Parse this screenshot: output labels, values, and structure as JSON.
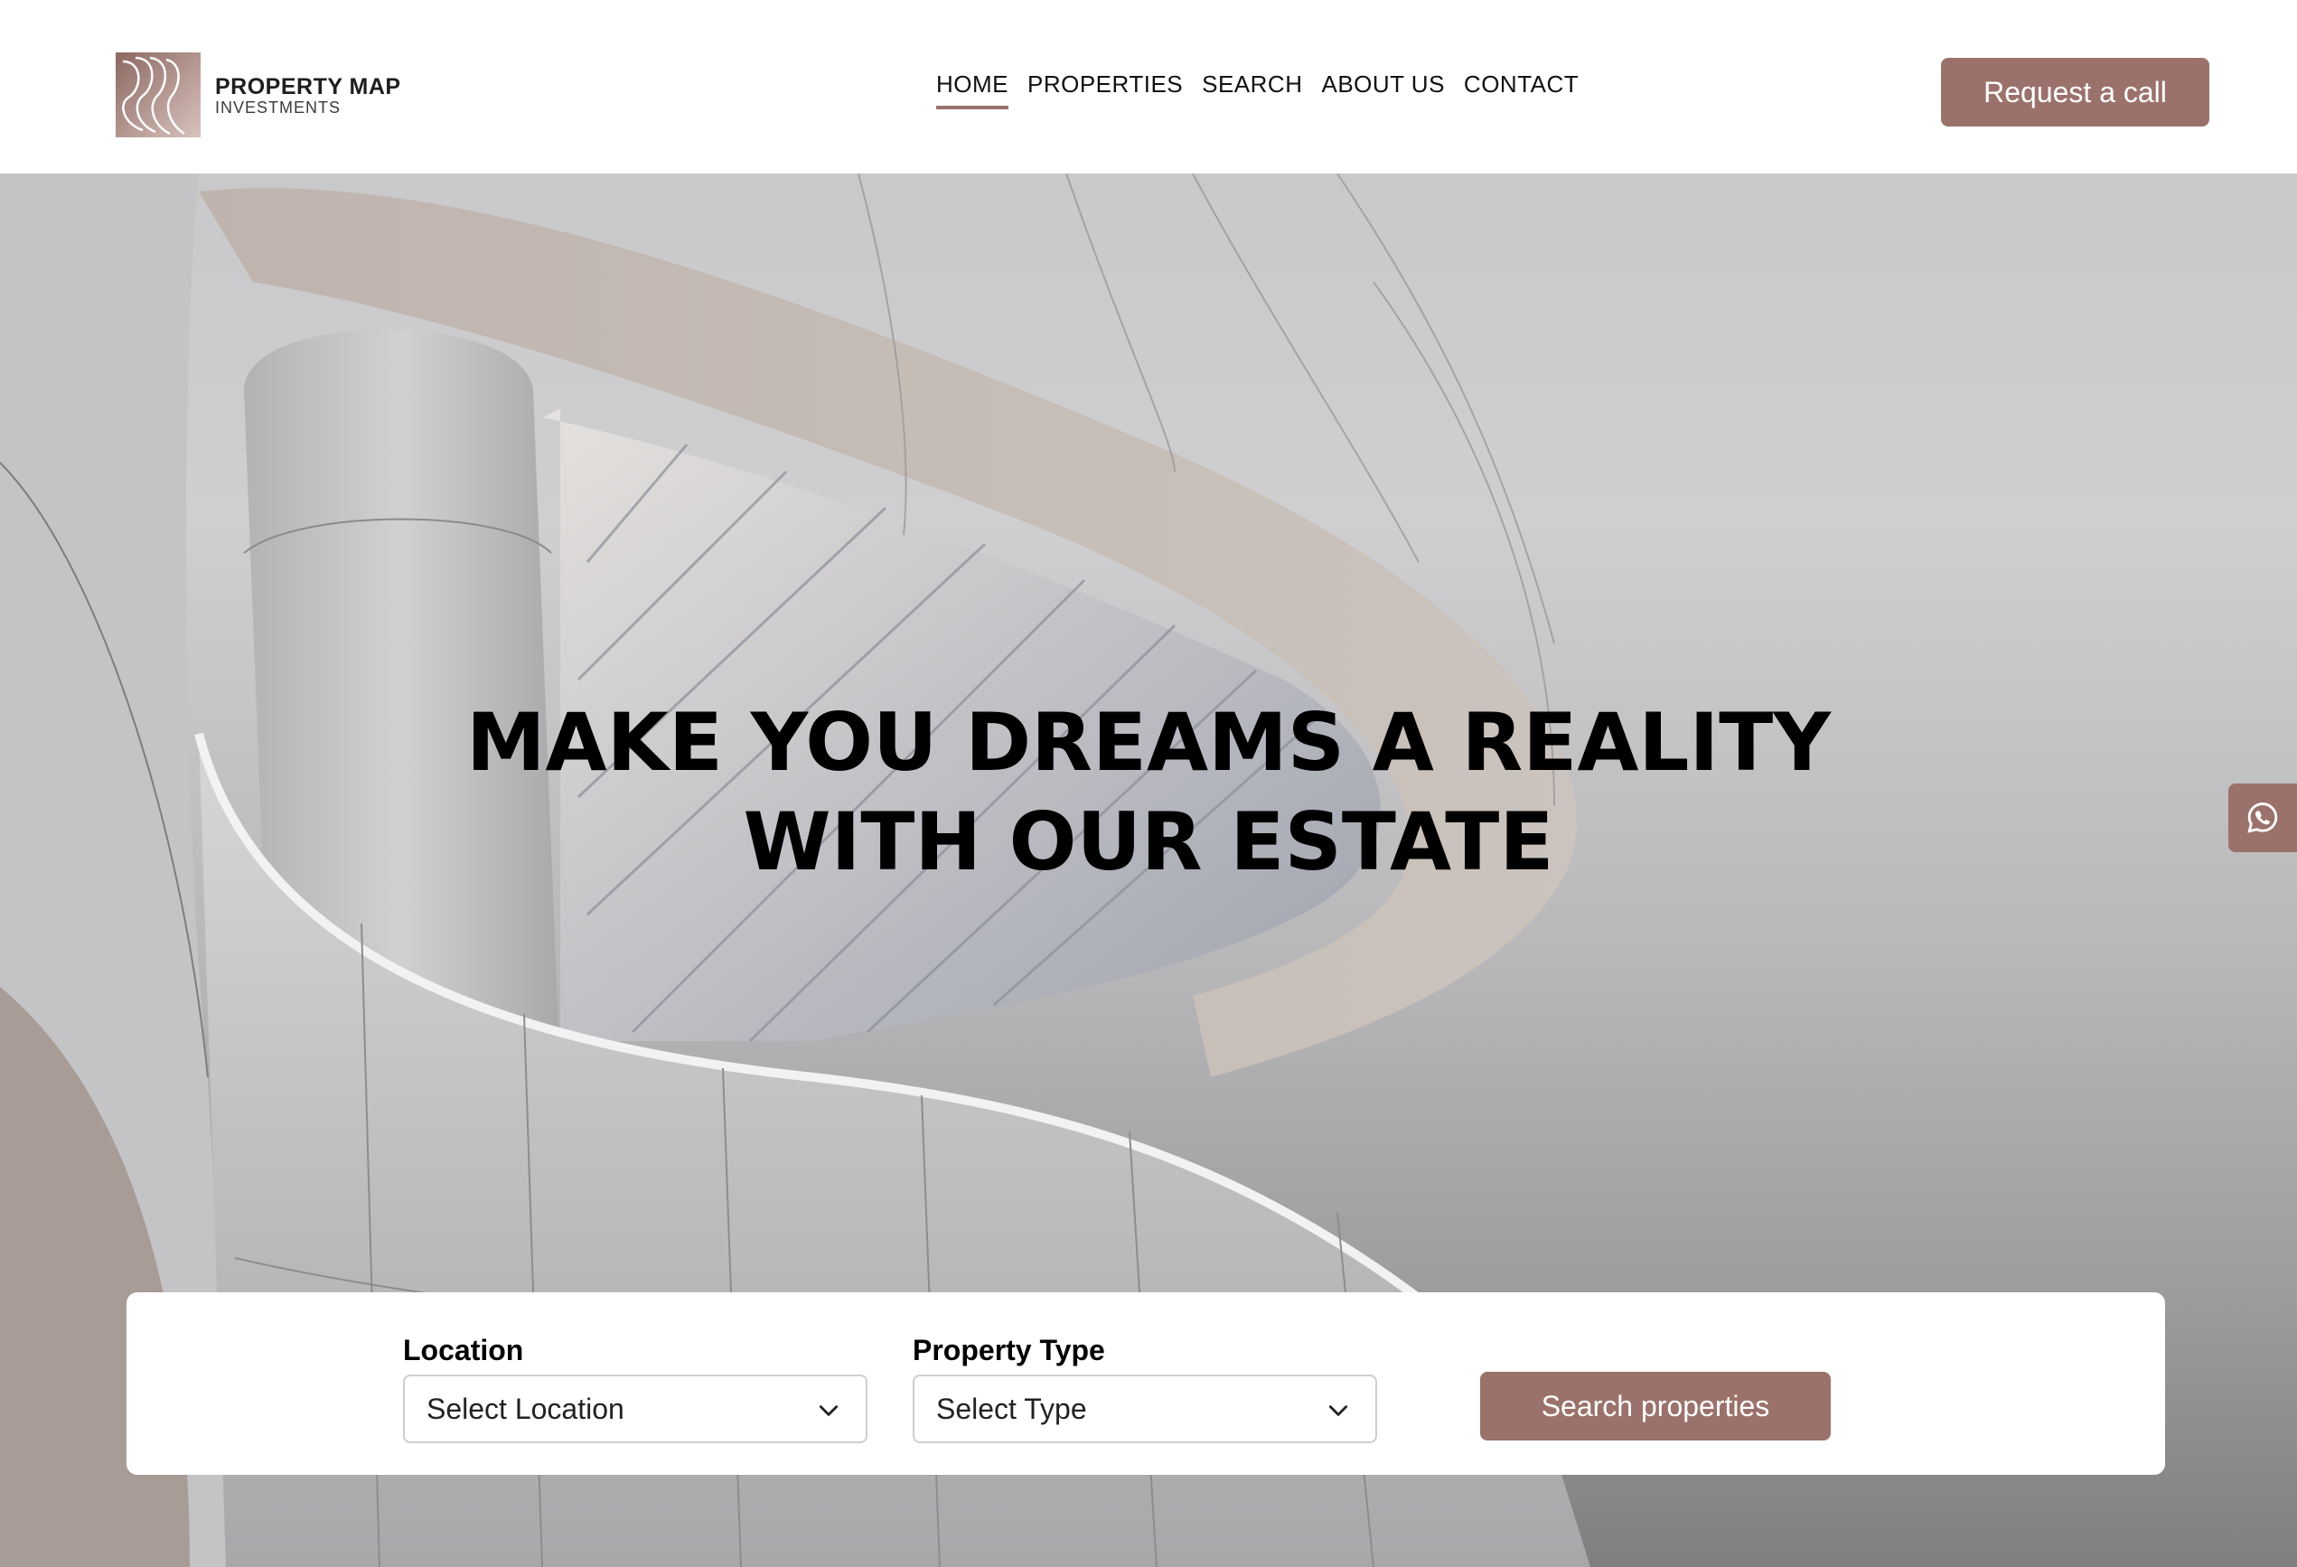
{
  "brand": {
    "name": "PROPERTY MAP",
    "subtitle": "INVESTMENTS",
    "accent": "#9b726b"
  },
  "nav": {
    "items": [
      {
        "label": "HOME",
        "active": true
      },
      {
        "label": "PROPERTIES",
        "active": false
      },
      {
        "label": "SEARCH",
        "active": false
      },
      {
        "label": "ABOUT US",
        "active": false
      },
      {
        "label": "CONTACT",
        "active": false
      }
    ]
  },
  "header": {
    "cta_label": "Request a call"
  },
  "hero": {
    "title_line1": "MAKE YOU DREAMS A REALITY",
    "title_line2": "WITH OUR ESTATE",
    "side_icon": "whatsapp-icon"
  },
  "search": {
    "location_label": "Location",
    "location_value": "Select Location",
    "type_label": "Property Type",
    "type_value": "Select Type",
    "button_label": "Search properties"
  }
}
